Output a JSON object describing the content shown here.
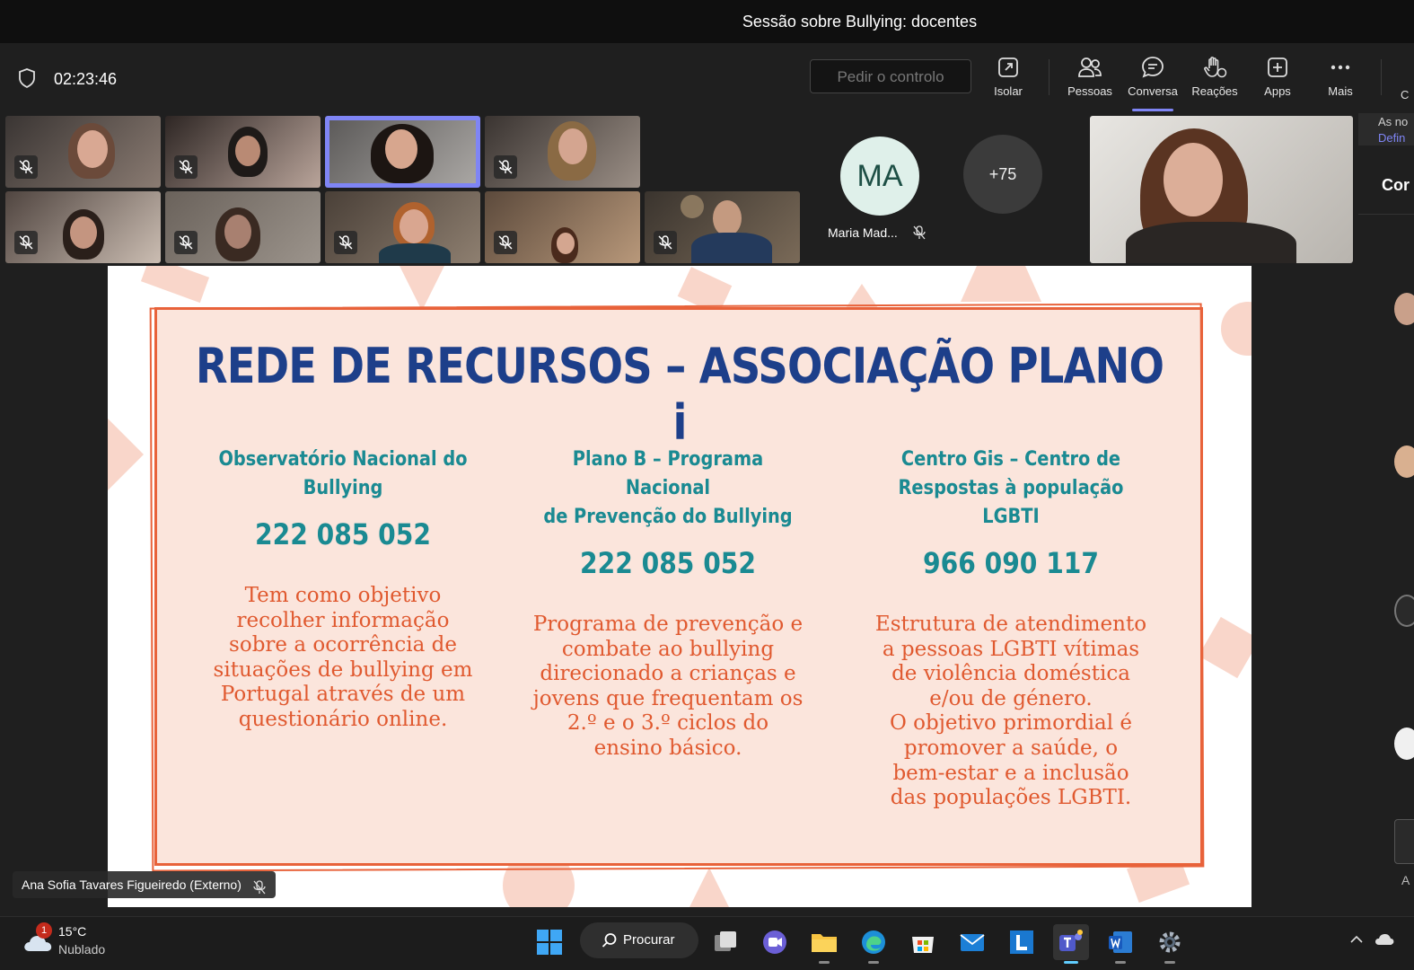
{
  "window": {
    "title": "Sessão sobre Bullying: docentes"
  },
  "toolbar": {
    "elapsed": "02:23:46",
    "request_control": "Pedir o controlo",
    "buttons": [
      {
        "label": "Isolar",
        "icon": "pop-out-icon"
      },
      {
        "label": "Pessoas",
        "icon": "people-icon"
      },
      {
        "label": "Conversa",
        "icon": "chat-icon",
        "active": true
      },
      {
        "label": "Reações",
        "icon": "raise-hand-icon"
      },
      {
        "label": "Apps",
        "icon": "add-app-icon"
      },
      {
        "label": "Mais",
        "icon": "more-icon"
      }
    ],
    "cut_label": "C"
  },
  "participants": {
    "avatar_initials": "MA",
    "avatar_name": "Maria Mad...",
    "overflow_count": "+75"
  },
  "side_panel": {
    "notice_line1": "As no",
    "notice_line2": "Defin",
    "header": "Cor",
    "footer_text": "A"
  },
  "slide": {
    "title": "REDE DE RECURSOS – ASSOCIAÇÃO PLANO i",
    "columns": [
      {
        "heading_lines": [
          "Observatório Nacional do",
          "Bullying"
        ],
        "phone": "222 085 052",
        "description_lines": [
          "Tem como objetivo",
          "recolher informação",
          "sobre a ocorrência de",
          "situações de bullying em",
          "Portugal através de um",
          "questionário online."
        ]
      },
      {
        "heading_lines": [
          "Plano B – Programa Nacional",
          "de Prevenção do Bullying"
        ],
        "phone": "222 085 052",
        "description_lines": [
          "Programa de prevenção e",
          "combate ao bullying",
          "direcionado a crianças e",
          "jovens que frequentam os",
          "2.º e o 3.º ciclos do",
          "ensino básico."
        ]
      },
      {
        "heading_lines": [
          "Centro Gis – Centro de",
          "Respostas à população LGBTI"
        ],
        "phone": "966 090 117",
        "description_lines": [
          "Estrutura de atendimento",
          "a pessoas LGBTI vítimas",
          "de violência doméstica",
          "e/ou de género.",
          "O objetivo primordial é",
          "promover a saúde, o",
          "bem-estar e a inclusão",
          "das populações LGBTI."
        ]
      }
    ]
  },
  "presenter": {
    "name": "Ana Sofia Tavares Figueiredo (Externo)"
  },
  "taskbar": {
    "weather_badge": "1",
    "temperature": "15°C",
    "condition": "Nublado",
    "search_label": "Procurar"
  },
  "colors": {
    "slide_title": "#1d3f8a",
    "slide_teal": "#1a8a92",
    "slide_orange": "#e0592f",
    "accent": "#7f85f5"
  }
}
